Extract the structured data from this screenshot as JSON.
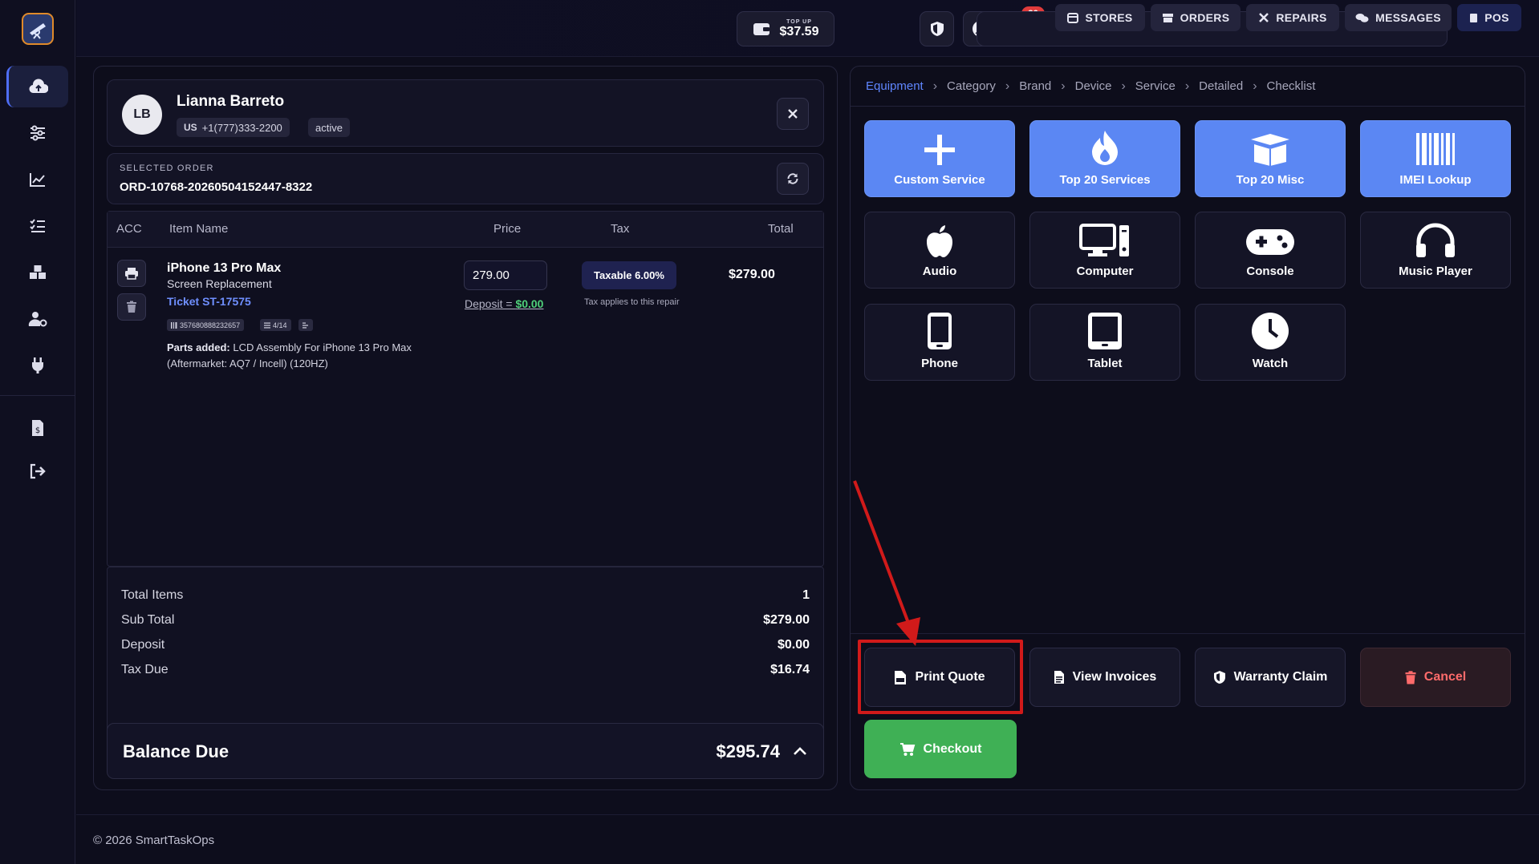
{
  "wallet": {
    "topup_label": "TOP UP",
    "amount": "$37.59"
  },
  "notifications": {
    "count": "36"
  },
  "nav": {
    "stores": "STORES",
    "orders": "ORDERS",
    "repairs": "REPAIRS",
    "messages": "MESSAGES",
    "pos": "POS"
  },
  "customer": {
    "initials": "LB",
    "name": "Lianna Barreto",
    "country": "US",
    "phone": "+1(777)333-2200",
    "status": "active"
  },
  "order": {
    "label": "SELECTED ORDER",
    "id": "ORD-10768-20260504152447-8322"
  },
  "table": {
    "headers": {
      "acc": "ACC",
      "item": "Item Name",
      "price": "Price",
      "tax": "Tax",
      "total": "Total"
    },
    "item": {
      "name": "iPhone 13 Pro Max",
      "service": "Screen Replacement",
      "ticket": "Ticket ST-17575",
      "imei": "357680888232657",
      "checklist": "4/14",
      "price": "279.00",
      "deposit_label": "Deposit = ",
      "deposit_value": "$0.00",
      "tax_badge": "Taxable 6.00%",
      "tax_note": "Tax applies to this repair",
      "total": "$279.00",
      "parts_label": "Parts added:",
      "parts_text": "LCD Assembly For iPhone 13 Pro Max (Aftermarket: AQ7 / Incell) (120HZ)"
    }
  },
  "summary": {
    "total_items_label": "Total Items",
    "total_items": "1",
    "sub_total_label": "Sub Total",
    "sub_total": "$279.00",
    "deposit_label": "Deposit",
    "deposit": "$0.00",
    "tax_due_label": "Tax Due",
    "tax_due": "$16.74",
    "balance_label": "Balance Due",
    "balance": "$295.74"
  },
  "breadcrumb": [
    "Equipment",
    "Category",
    "Brand",
    "Device",
    "Service",
    "Detailed",
    "Checklist"
  ],
  "quick_tiles": [
    "Custom Service",
    "Top 20 Services",
    "Top 20 Misc",
    "IMEI Lookup"
  ],
  "categories": [
    "Audio",
    "Computer",
    "Console",
    "Music Player",
    "Phone",
    "Tablet",
    "Watch"
  ],
  "actions": {
    "print_quote": "Print Quote",
    "view_invoices": "View Invoices",
    "warranty_claim": "Warranty Claim",
    "cancel": "Cancel",
    "checkout": "Checkout"
  },
  "footer": "© 2026 SmartTaskOps",
  "colors": {
    "accent": "#5b87f3",
    "checkout": "#3fb055",
    "cancel": "#ff6b6b",
    "highlight": "#d11a1a",
    "badge": "#e03b3b"
  }
}
